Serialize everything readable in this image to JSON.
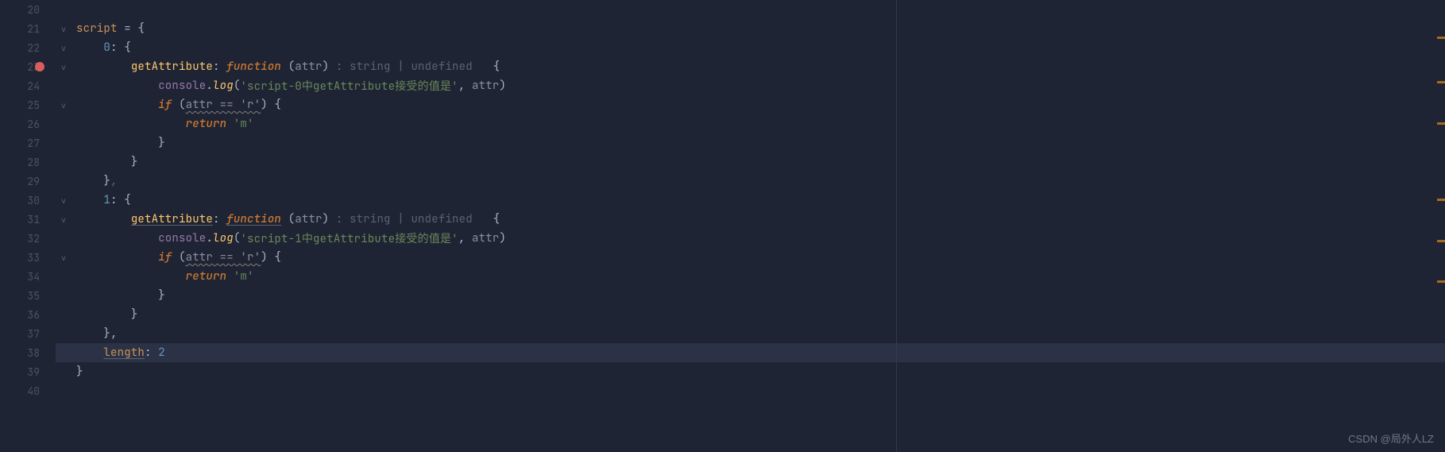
{
  "line_numbers": [
    "20",
    "21",
    "22",
    "23",
    "24",
    "25",
    "26",
    "27",
    "28",
    "29",
    "30",
    "31",
    "32",
    "33",
    "34",
    "35",
    "36",
    "37",
    "38",
    "39",
    "40"
  ],
  "folds": {
    "1": "v",
    "2": "v",
    "3": "v",
    "5": "v",
    "10": "v",
    "11": "v",
    "13": "v"
  },
  "breakpoint_row": 3,
  "highlight_row": 18,
  "code": {
    "l1": {
      "var": "script",
      "op": " = ",
      "brace": "{"
    },
    "l2": {
      "num": "0",
      "colon": ": ",
      "brace": "{"
    },
    "l3": {
      "prop": "getAttribute",
      "colon": ": ",
      "kw": "function",
      "lp": " (",
      "param": "attr",
      "rp": ") ",
      "ghost": ": string | undefined ",
      "brace": "  {"
    },
    "l4": {
      "obj": "console",
      "dot": ".",
      "fn": "log",
      "lp": "(",
      "str": "'script-0中getAttribute接受的值是'",
      "comma": ", ",
      "param": "attr",
      "rp": ")"
    },
    "l5": {
      "kw": "if",
      "lp": " (",
      "cond": "attr == 'r'",
      "rp": ") ",
      "brace": "{"
    },
    "l6": {
      "kw": "return",
      "sp": " ",
      "str": "'m'"
    },
    "l7": {
      "brace": "}"
    },
    "l8": {
      "brace": "}"
    },
    "l9": {
      "brace": "}",
      "tail": ","
    },
    "l10": {
      "num": "1",
      "colon": ": ",
      "brace": "{"
    },
    "l11": {
      "prop": "getAttribute",
      "colon": ": ",
      "kw": "function",
      "lp": " (",
      "param": "attr",
      "rp": ") ",
      "ghost": ": string | undefined ",
      "brace": "  {"
    },
    "l12": {
      "obj": "console",
      "dot": ".",
      "fn": "log",
      "lp": "(",
      "str": "'script-1中getAttribute接受的值是'",
      "comma": ", ",
      "param": "attr",
      "rp": ")"
    },
    "l13": {
      "kw": "if",
      "lp": " (",
      "cond": "attr == 'r'",
      "rp": ") ",
      "brace": "{"
    },
    "l14": {
      "kw": "return",
      "sp": " ",
      "str": "'m'"
    },
    "l15": {
      "brace": "}"
    },
    "l16": {
      "brace": "}"
    },
    "l17": {
      "brace": "}",
      "tail": ","
    },
    "l18": {
      "prop": "length",
      "colon": ": ",
      "num": "2"
    },
    "l19": {
      "brace": "}"
    }
  },
  "watermark": "CSDN @局外人LZ",
  "error_marks_top_pct": [
    8,
    18,
    27,
    44,
    53,
    62
  ]
}
